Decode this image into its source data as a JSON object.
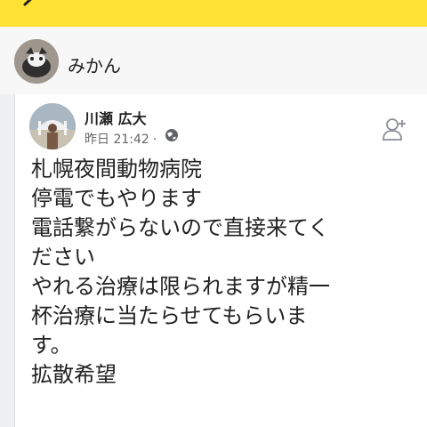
{
  "header": {
    "user_name": "みかん"
  },
  "post": {
    "author": "川瀬 広大",
    "timestamp": "昨日 21:42",
    "separator": "·",
    "lines": [
      "札幌夜間動物病院",
      "停電でもやります",
      "電話繋がらないので直接来てく",
      "ださい",
      "やれる治療は限られますが精一",
      "杯治療に当たらせてもらいま",
      "す。",
      "拡散希望"
    ]
  },
  "icons": {
    "back": "back-icon",
    "privacy": "globe-icon",
    "follow": "add-friend-icon"
  },
  "colors": {
    "topbar": "#ffe233",
    "text": "#222222",
    "meta": "#666666"
  }
}
